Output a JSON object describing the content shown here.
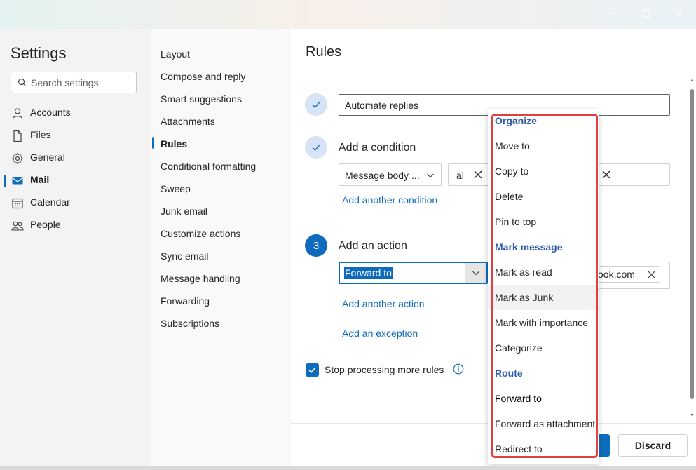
{
  "settings": {
    "title": "Settings",
    "search_placeholder": "Search settings",
    "nav": [
      {
        "label": "Accounts",
        "icon": "person-icon"
      },
      {
        "label": "Files",
        "icon": "file-icon"
      },
      {
        "label": "General",
        "icon": "gear-icon"
      },
      {
        "label": "Mail",
        "icon": "mail-icon",
        "active": true
      },
      {
        "label": "Calendar",
        "icon": "calendar-icon"
      },
      {
        "label": "People",
        "icon": "people-icon"
      }
    ]
  },
  "mail_settings": {
    "items": [
      "Layout",
      "Compose and reply",
      "Smart suggestions",
      "Attachments",
      "Rules",
      "Conditional formatting",
      "Sweep",
      "Junk email",
      "Customize actions",
      "Sync email",
      "Message handling",
      "Forwarding",
      "Subscriptions"
    ],
    "active": "Rules"
  },
  "rules": {
    "title": "Rules",
    "rule_name": "Automate replies",
    "condition_label": "Add a condition",
    "condition_type": "Message body ...",
    "condition_value": "ai",
    "add_condition_link": "Add another condition",
    "step3_number": "3",
    "action_label": "Add an action",
    "action_selected": "Forward to",
    "recipient_visible": "ook.com",
    "add_action_link": "Add another action",
    "add_exception_link": "Add an exception",
    "stop_processing_label": "Stop processing more rules",
    "stop_processing_checked": true,
    "discard_label": "Discard"
  },
  "action_menu": {
    "items": [
      {
        "label": "Organize",
        "type": "header"
      },
      {
        "label": "Move to",
        "type": "item"
      },
      {
        "label": "Copy to",
        "type": "item"
      },
      {
        "label": "Delete",
        "type": "item"
      },
      {
        "label": "Pin to top",
        "type": "item"
      },
      {
        "label": "Mark message",
        "type": "header"
      },
      {
        "label": "Mark as read",
        "type": "item"
      },
      {
        "label": "Mark as Junk",
        "type": "item",
        "hover": true
      },
      {
        "label": "Mark with importance",
        "type": "item"
      },
      {
        "label": "Categorize",
        "type": "item"
      },
      {
        "label": "Route",
        "type": "header"
      },
      {
        "label": "Forward to",
        "type": "item",
        "selected": true
      },
      {
        "label": "Forward as attachment",
        "type": "item"
      },
      {
        "label": "Redirect to",
        "type": "item"
      }
    ]
  },
  "colors": {
    "accent": "#0f6cbd",
    "header_text": "#2e5bb0",
    "highlight_outline": "#e0403f"
  }
}
